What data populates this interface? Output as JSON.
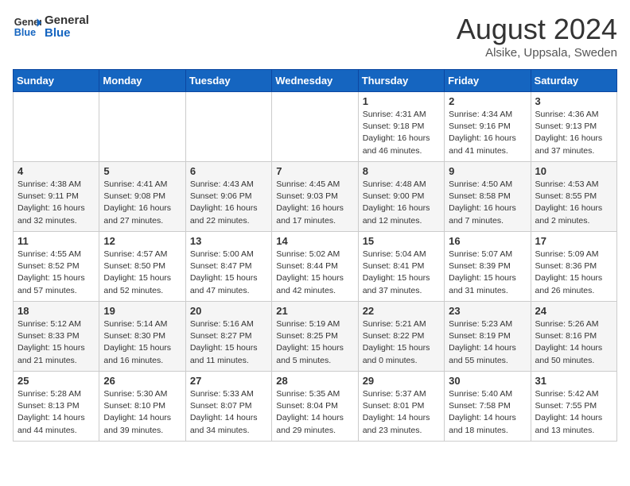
{
  "header": {
    "logo_general": "General",
    "logo_blue": "Blue",
    "month_title": "August 2024",
    "location": "Alsike, Uppsala, Sweden"
  },
  "weekdays": [
    "Sunday",
    "Monday",
    "Tuesday",
    "Wednesday",
    "Thursday",
    "Friday",
    "Saturday"
  ],
  "weeks": [
    [
      {
        "day": "",
        "info": ""
      },
      {
        "day": "",
        "info": ""
      },
      {
        "day": "",
        "info": ""
      },
      {
        "day": "",
        "info": ""
      },
      {
        "day": "1",
        "info": "Sunrise: 4:31 AM\nSunset: 9:18 PM\nDaylight: 16 hours\nand 46 minutes."
      },
      {
        "day": "2",
        "info": "Sunrise: 4:34 AM\nSunset: 9:16 PM\nDaylight: 16 hours\nand 41 minutes."
      },
      {
        "day": "3",
        "info": "Sunrise: 4:36 AM\nSunset: 9:13 PM\nDaylight: 16 hours\nand 37 minutes."
      }
    ],
    [
      {
        "day": "4",
        "info": "Sunrise: 4:38 AM\nSunset: 9:11 PM\nDaylight: 16 hours\nand 32 minutes."
      },
      {
        "day": "5",
        "info": "Sunrise: 4:41 AM\nSunset: 9:08 PM\nDaylight: 16 hours\nand 27 minutes."
      },
      {
        "day": "6",
        "info": "Sunrise: 4:43 AM\nSunset: 9:06 PM\nDaylight: 16 hours\nand 22 minutes."
      },
      {
        "day": "7",
        "info": "Sunrise: 4:45 AM\nSunset: 9:03 PM\nDaylight: 16 hours\nand 17 minutes."
      },
      {
        "day": "8",
        "info": "Sunrise: 4:48 AM\nSunset: 9:00 PM\nDaylight: 16 hours\nand 12 minutes."
      },
      {
        "day": "9",
        "info": "Sunrise: 4:50 AM\nSunset: 8:58 PM\nDaylight: 16 hours\nand 7 minutes."
      },
      {
        "day": "10",
        "info": "Sunrise: 4:53 AM\nSunset: 8:55 PM\nDaylight: 16 hours\nand 2 minutes."
      }
    ],
    [
      {
        "day": "11",
        "info": "Sunrise: 4:55 AM\nSunset: 8:52 PM\nDaylight: 15 hours\nand 57 minutes."
      },
      {
        "day": "12",
        "info": "Sunrise: 4:57 AM\nSunset: 8:50 PM\nDaylight: 15 hours\nand 52 minutes."
      },
      {
        "day": "13",
        "info": "Sunrise: 5:00 AM\nSunset: 8:47 PM\nDaylight: 15 hours\nand 47 minutes."
      },
      {
        "day": "14",
        "info": "Sunrise: 5:02 AM\nSunset: 8:44 PM\nDaylight: 15 hours\nand 42 minutes."
      },
      {
        "day": "15",
        "info": "Sunrise: 5:04 AM\nSunset: 8:41 PM\nDaylight: 15 hours\nand 37 minutes."
      },
      {
        "day": "16",
        "info": "Sunrise: 5:07 AM\nSunset: 8:39 PM\nDaylight: 15 hours\nand 31 minutes."
      },
      {
        "day": "17",
        "info": "Sunrise: 5:09 AM\nSunset: 8:36 PM\nDaylight: 15 hours\nand 26 minutes."
      }
    ],
    [
      {
        "day": "18",
        "info": "Sunrise: 5:12 AM\nSunset: 8:33 PM\nDaylight: 15 hours\nand 21 minutes."
      },
      {
        "day": "19",
        "info": "Sunrise: 5:14 AM\nSunset: 8:30 PM\nDaylight: 15 hours\nand 16 minutes."
      },
      {
        "day": "20",
        "info": "Sunrise: 5:16 AM\nSunset: 8:27 PM\nDaylight: 15 hours\nand 11 minutes."
      },
      {
        "day": "21",
        "info": "Sunrise: 5:19 AM\nSunset: 8:25 PM\nDaylight: 15 hours\nand 5 minutes."
      },
      {
        "day": "22",
        "info": "Sunrise: 5:21 AM\nSunset: 8:22 PM\nDaylight: 15 hours\nand 0 minutes."
      },
      {
        "day": "23",
        "info": "Sunrise: 5:23 AM\nSunset: 8:19 PM\nDaylight: 14 hours\nand 55 minutes."
      },
      {
        "day": "24",
        "info": "Sunrise: 5:26 AM\nSunset: 8:16 PM\nDaylight: 14 hours\nand 50 minutes."
      }
    ],
    [
      {
        "day": "25",
        "info": "Sunrise: 5:28 AM\nSunset: 8:13 PM\nDaylight: 14 hours\nand 44 minutes."
      },
      {
        "day": "26",
        "info": "Sunrise: 5:30 AM\nSunset: 8:10 PM\nDaylight: 14 hours\nand 39 minutes."
      },
      {
        "day": "27",
        "info": "Sunrise: 5:33 AM\nSunset: 8:07 PM\nDaylight: 14 hours\nand 34 minutes."
      },
      {
        "day": "28",
        "info": "Sunrise: 5:35 AM\nSunset: 8:04 PM\nDaylight: 14 hours\nand 29 minutes."
      },
      {
        "day": "29",
        "info": "Sunrise: 5:37 AM\nSunset: 8:01 PM\nDaylight: 14 hours\nand 23 minutes."
      },
      {
        "day": "30",
        "info": "Sunrise: 5:40 AM\nSunset: 7:58 PM\nDaylight: 14 hours\nand 18 minutes."
      },
      {
        "day": "31",
        "info": "Sunrise: 5:42 AM\nSunset: 7:55 PM\nDaylight: 14 hours\nand 13 minutes."
      }
    ]
  ]
}
